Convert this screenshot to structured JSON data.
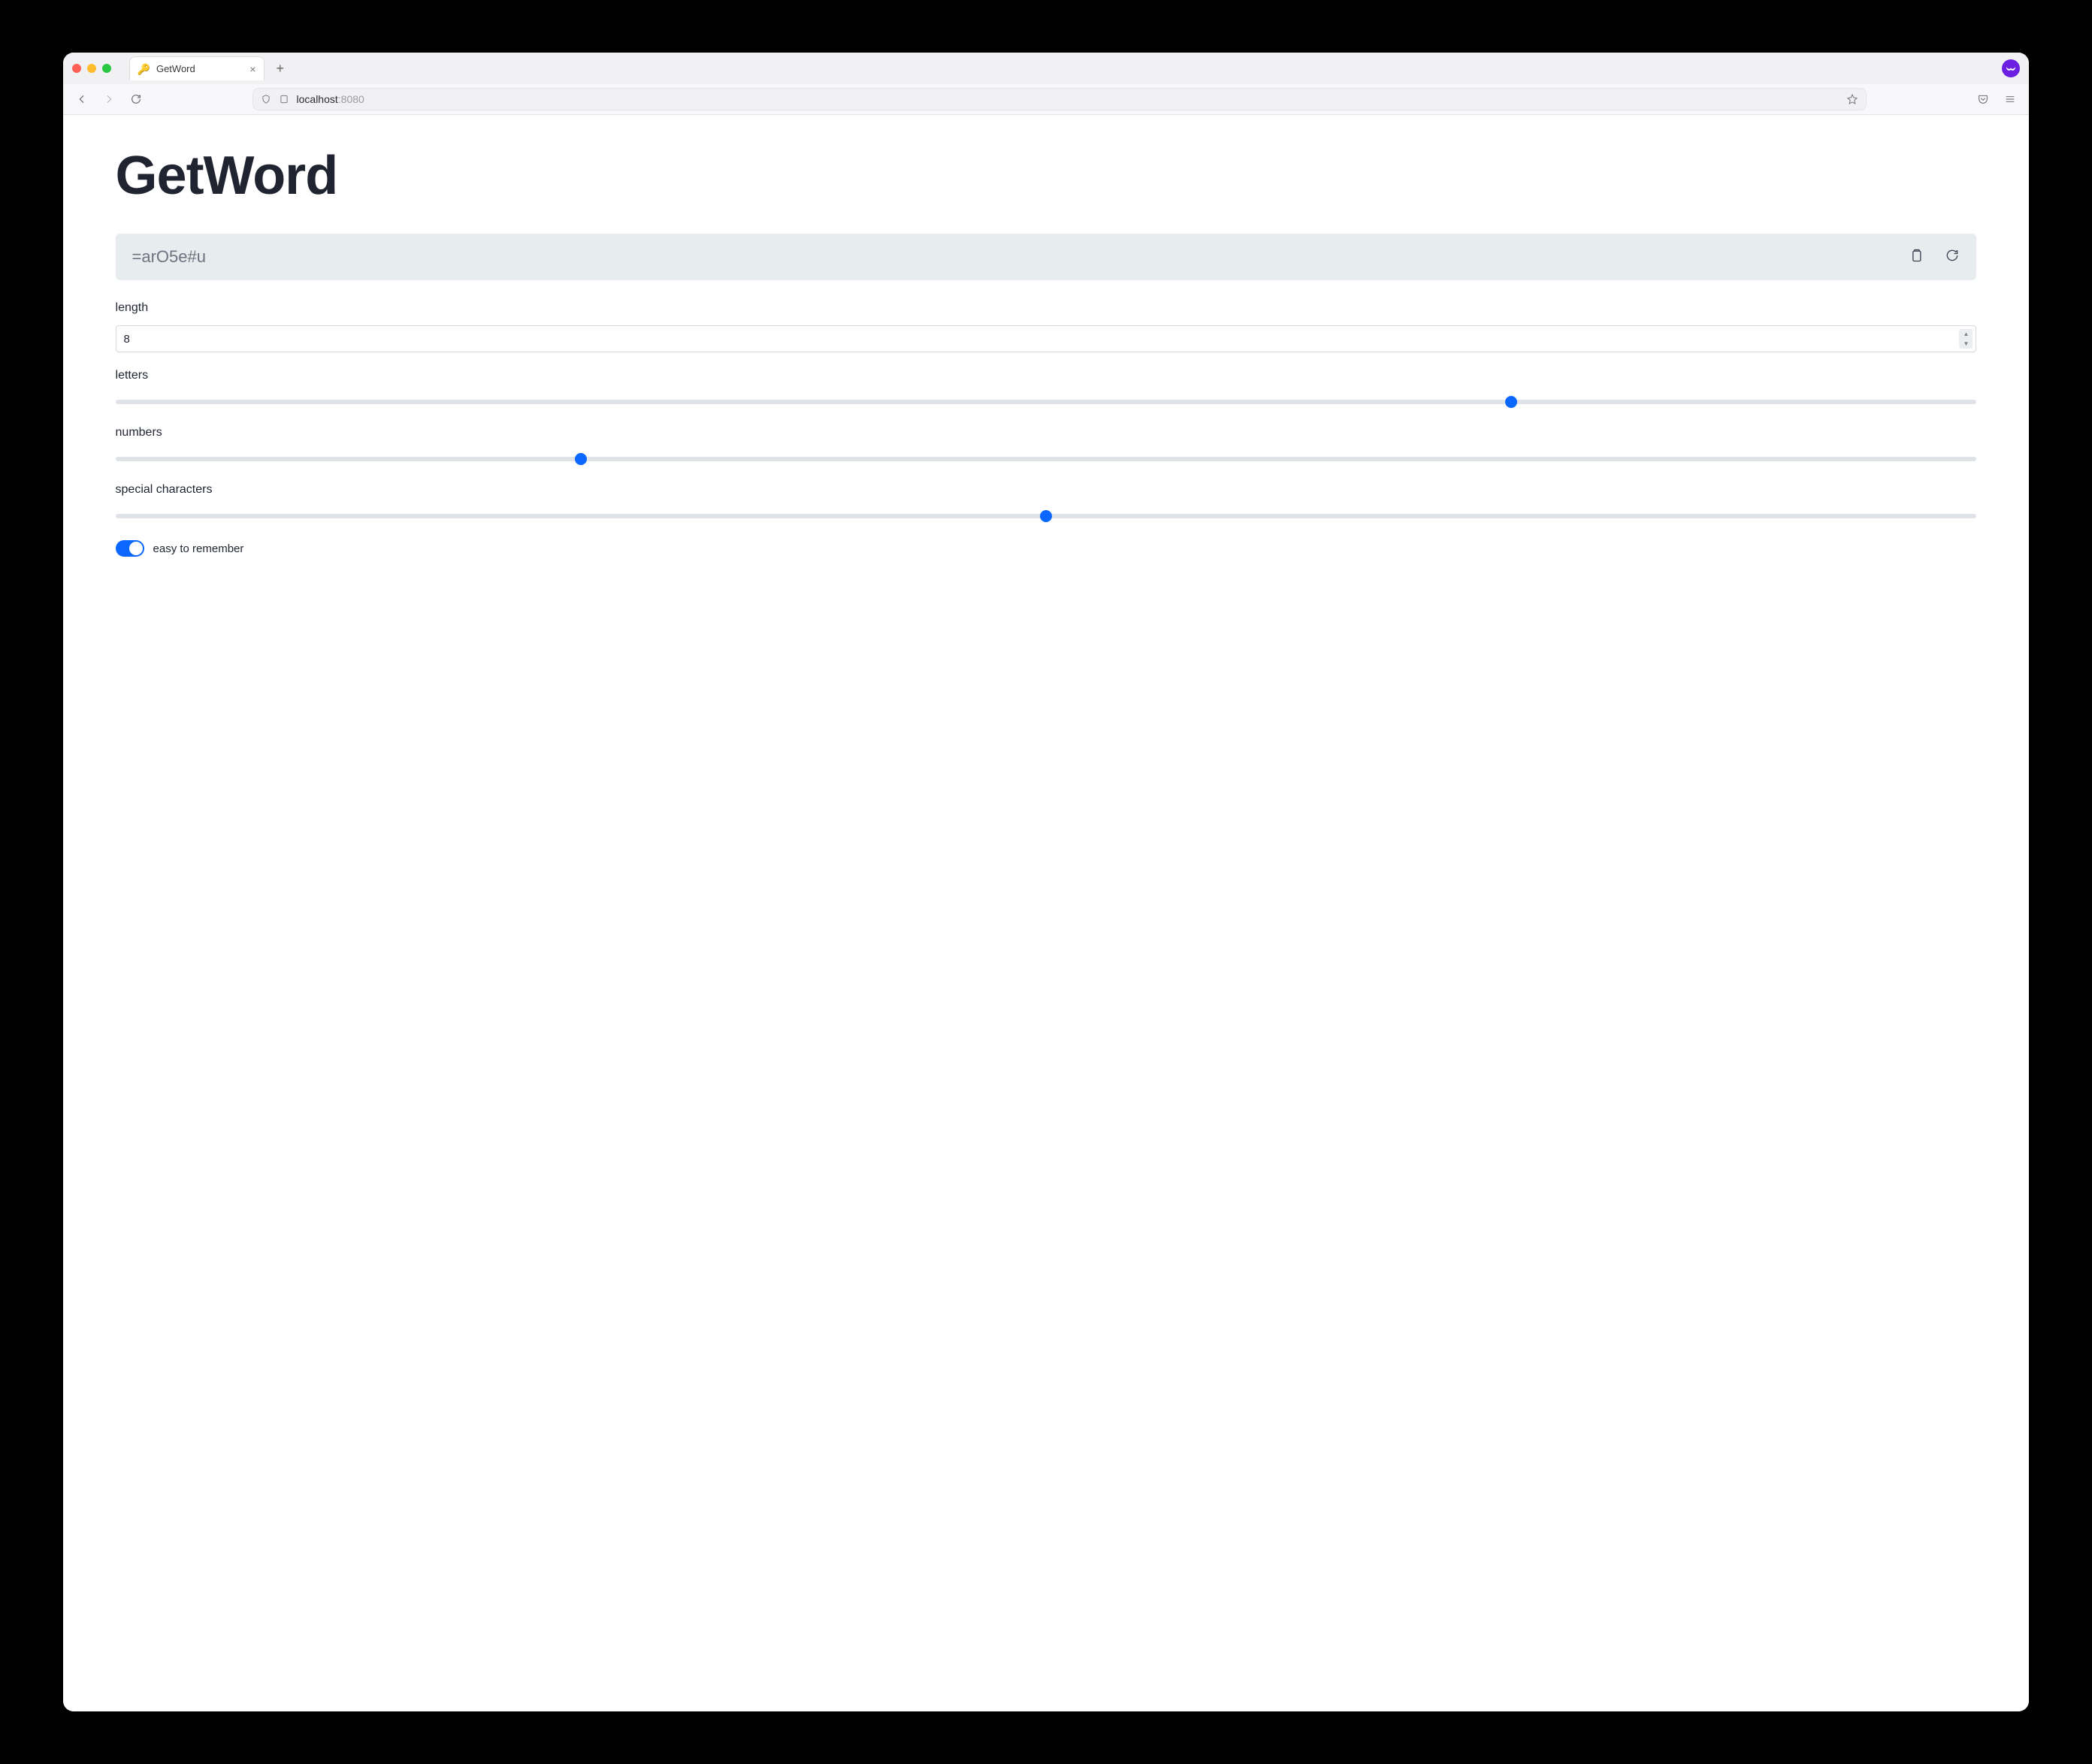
{
  "browser": {
    "tab_title": "GetWord",
    "url_host": "localhost",
    "url_port": ":8080"
  },
  "app": {
    "title": "GetWord",
    "password": "=arO5e#u",
    "length_label": "length",
    "length_value": "8",
    "letters_label": "letters",
    "numbers_label": "numbers",
    "special_label": "special characters",
    "remember_label": "easy to remember",
    "remember_on": true,
    "slider_positions": {
      "letters_pct": 75,
      "numbers_pct": 25,
      "special_pct": 50
    }
  }
}
